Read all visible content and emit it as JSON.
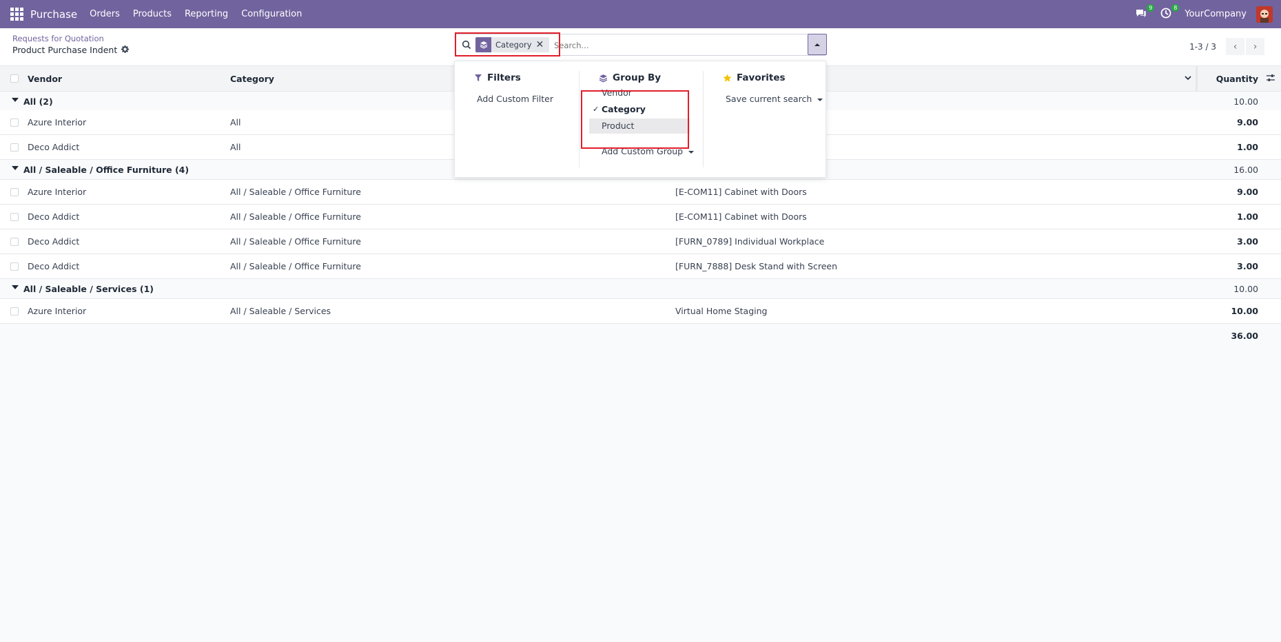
{
  "navbar": {
    "app_name": "Purchase",
    "menu": [
      "Orders",
      "Products",
      "Reporting",
      "Configuration"
    ],
    "messages_count": "9",
    "activities_count": "8",
    "company": "YourCompany",
    "accent_color": "#71639e"
  },
  "control_panel": {
    "breadcrumb": "Requests for Quotation",
    "title": "Product Purchase Indent",
    "pager_value": "1-3 / 3"
  },
  "search": {
    "facet_label": "Category",
    "facet_icon": "layers-icon",
    "placeholder": "Search..."
  },
  "dropdown": {
    "filters_title": "Filters",
    "add_custom_filter": "Add Custom Filter",
    "groupby_title": "Group By",
    "groupby_options": [
      {
        "label": "Vendor",
        "selected": false
      },
      {
        "label": "Category",
        "selected": true
      },
      {
        "label": "Product",
        "selected": false
      }
    ],
    "add_custom_group": "Add Custom Group",
    "favorites_title": "Favorites",
    "save_current_search": "Save current search"
  },
  "table": {
    "headers": {
      "vendor": "Vendor",
      "category": "Category",
      "quantity": "Quantity"
    },
    "groups": [
      {
        "label": "All (2)",
        "total": "10.00",
        "rows": [
          {
            "vendor": "Azure Interior",
            "category": "All",
            "product": "",
            "qty": "9.00"
          },
          {
            "vendor": "Deco Addict",
            "category": "All",
            "product": "",
            "qty": "1.00"
          }
        ]
      },
      {
        "label": "All / Saleable / Office Furniture (4)",
        "total": "16.00",
        "rows": [
          {
            "vendor": "Azure Interior",
            "category": "All / Saleable / Office Furniture",
            "product": "[E-COM11] Cabinet with Doors",
            "qty": "9.00"
          },
          {
            "vendor": "Deco Addict",
            "category": "All / Saleable / Office Furniture",
            "product": "[E-COM11] Cabinet with Doors",
            "qty": "1.00"
          },
          {
            "vendor": "Deco Addict",
            "category": "All / Saleable / Office Furniture",
            "product": "[FURN_0789] Individual Workplace",
            "qty": "3.00"
          },
          {
            "vendor": "Deco Addict",
            "category": "All / Saleable / Office Furniture",
            "product": "[FURN_7888] Desk Stand with Screen",
            "qty": "3.00"
          }
        ]
      },
      {
        "label": "All / Saleable / Services (1)",
        "total": "10.00",
        "rows": [
          {
            "vendor": "Azure Interior",
            "category": "All / Saleable / Services",
            "product": "Virtual Home Staging",
            "qty": "10.00"
          }
        ]
      }
    ],
    "grand_total": "36.00"
  }
}
